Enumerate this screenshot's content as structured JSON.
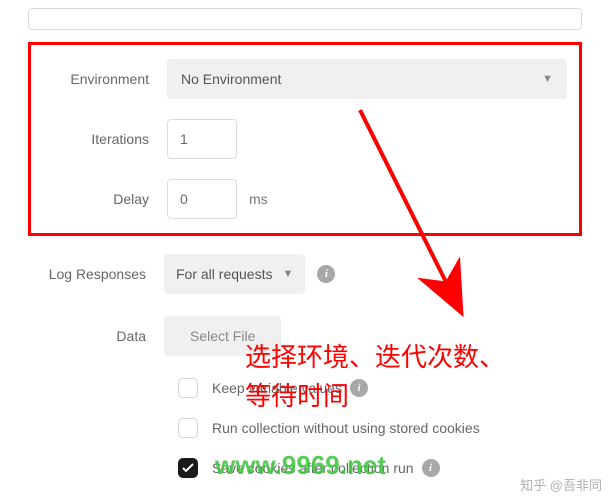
{
  "fields": {
    "environment": {
      "label": "Environment",
      "value": "No Environment"
    },
    "iterations": {
      "label": "Iterations",
      "value": "1"
    },
    "delay": {
      "label": "Delay",
      "value": "0",
      "unit": "ms"
    },
    "log_responses": {
      "label": "Log Responses",
      "value": "For all requests"
    },
    "data": {
      "label": "Data",
      "button": "Select File"
    }
  },
  "checkboxes": {
    "keep_vars": {
      "label": "Keep variable values",
      "checked": false,
      "info": true
    },
    "no_cookies": {
      "label": "Run collection without using stored cookies",
      "checked": false,
      "info": false
    },
    "save_cookies": {
      "label": "Save cookies after collection run",
      "checked": true,
      "info": true
    }
  },
  "annotation": {
    "line1": "选择环境、迭代次数、",
    "line2": "等待时间"
  },
  "watermark_green": "www.9969.net",
  "watermark_corner": "知乎 @吾非同",
  "info_glyph": "i"
}
